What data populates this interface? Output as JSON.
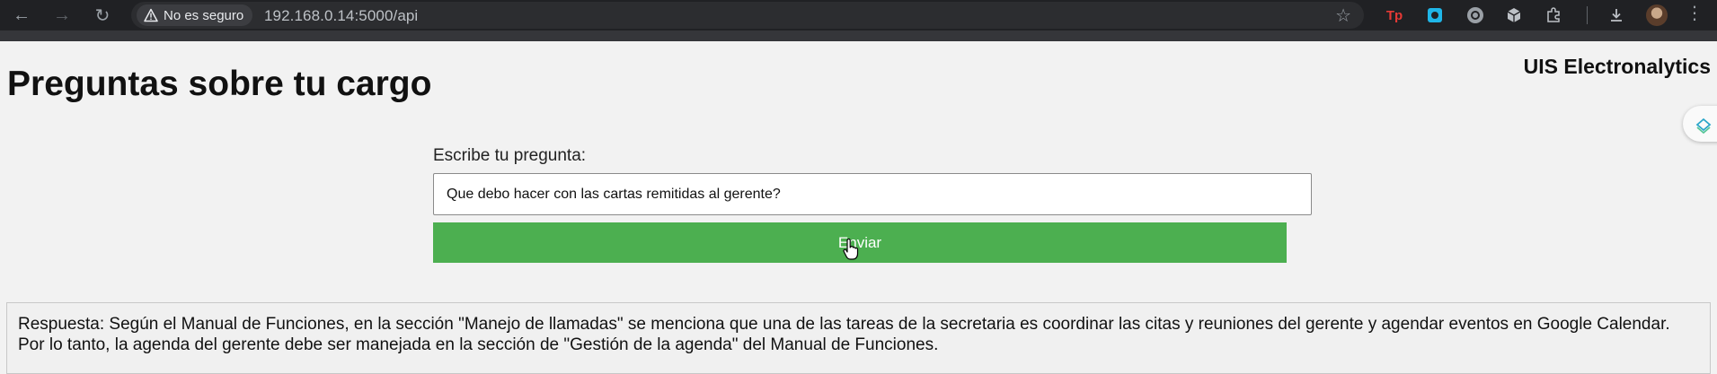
{
  "browser": {
    "security_label": "No es seguro",
    "url": "192.168.0.14:5000/api",
    "nav_icons": [
      "back-icon",
      "forward-icon",
      "reload-icon"
    ],
    "extension_icons": [
      "tp-extension-icon",
      "camera-extension-icon",
      "openai-extension-icon",
      "cube-extension-icon",
      "puzzle-extension-icon",
      "download-icon"
    ]
  },
  "header": {
    "brand": "UIS Electronalytics",
    "title": "Preguntas sobre tu cargo"
  },
  "form": {
    "label": "Escribe tu pregunta:",
    "input_value": "Que debo hacer con las cartas remitidas al gerente?",
    "submit_label": "Enviar"
  },
  "answer": {
    "text": "Respuesta: Según el Manual de Funciones, en la sección \"Manejo de llamadas\" se menciona que una de las tareas de la secretaria es coordinar las citas y reuniones del gerente y agendar eventos en Google Calendar. Por lo tanto, la agenda del gerente debe ser manejada en la sección de \"Gestión de la agenda\" del Manual de Funciones."
  },
  "colors": {
    "submit_button": "#4caf50",
    "page_background": "#f2f2f2",
    "toolbar": "#202124"
  }
}
